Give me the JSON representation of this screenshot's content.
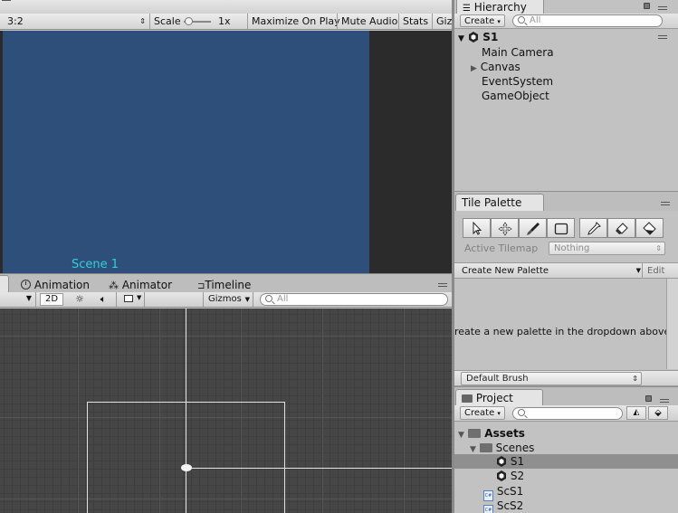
{
  "game_view": {
    "aspect": "3:2",
    "scale_label": "Scale",
    "scale_value": "1x",
    "maximize_on_play": "Maximize On Play",
    "mute_audio": "Mute Audio",
    "stats": "Stats",
    "gizmos_cut": "Giz",
    "canvas_color": "#2e4f7a",
    "scene_text": "Scene 1",
    "scene_text_color": "#33cfd8"
  },
  "bottom_tabs": {
    "animation": "Animation",
    "animator": "Animator",
    "timeline": "Timeline"
  },
  "scene_view": {
    "mode_2d": "2D",
    "gizmos": "Gizmos",
    "search_placeholder": "All"
  },
  "hierarchy": {
    "tab_label": "Hierarchy",
    "create_label": "Create",
    "search_placeholder": "All",
    "scene_name": "S1",
    "items": [
      "Main Camera",
      "Canvas",
      "EventSystem",
      "GameObject"
    ]
  },
  "tile_palette": {
    "tab_label": "Tile Palette",
    "active_tilemap_label": "Active Tilemap",
    "active_tilemap_value": "Nothing",
    "palette_dropdown": "Create New Palette",
    "edit_label": "Edit",
    "empty_message": "reate a new palette in the dropdown above",
    "brush_dropdown": "Default Brush"
  },
  "project": {
    "tab_label": "Project",
    "create_label": "Create",
    "assets_label": "Assets",
    "scenes_folder": "Scenes",
    "scene_files": [
      "S1",
      "S2"
    ],
    "scripts": [
      "ScS1",
      "ScS2"
    ],
    "selected_color": "#8f8f8f"
  }
}
